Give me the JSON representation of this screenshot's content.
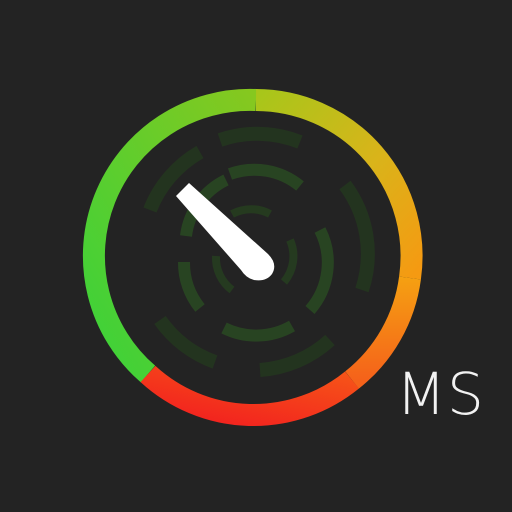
{
  "app_icon": {
    "unit_label": "MS",
    "colors": {
      "background": "#232323",
      "ring_green": "#2fc53a",
      "ring_yellow": "#c8c219",
      "ring_orange": "#f09a14",
      "ring_red": "#f52d1e",
      "inner_marks": "#2c4a25",
      "needle": "#ffffff"
    },
    "icons": {
      "gauge": "speedometer-gauge-icon",
      "needle": "gauge-needle-icon"
    }
  }
}
